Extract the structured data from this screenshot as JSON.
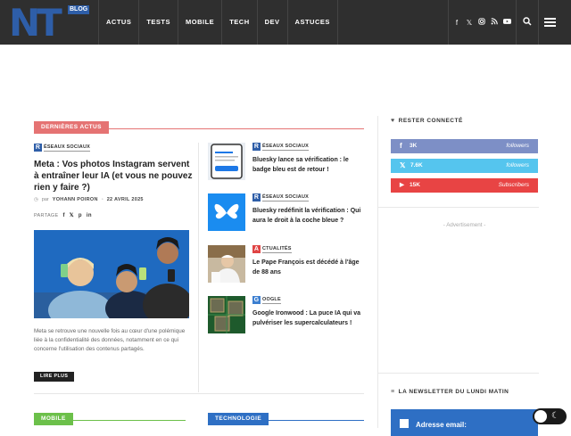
{
  "header": {
    "logo": {
      "text": "NT",
      "tag": "BLOG"
    },
    "nav": [
      "ACTUS",
      "TESTS",
      "MOBILE",
      "TECH",
      "DEV",
      "ASTUCES"
    ],
    "social_icons": [
      "facebook-icon",
      "x-icon",
      "instagram-icon",
      "rss-icon",
      "youtube-icon"
    ]
  },
  "main": {
    "section_label": "DERNIÈRES ACTUS",
    "lead": {
      "category_letter": "R",
      "category_rest": "ÉSEAUX SOCIAUX",
      "title": "Meta : Vos photos Instagram servent à entraîner leur IA (et vous ne pouvez rien y faire ?)",
      "by": "par",
      "author": "YOHANN POIRON",
      "date": "22 AVRIL 2025",
      "share_label": "PARTAGE",
      "share_icons": [
        "f",
        "𝕏",
        "p",
        "in"
      ],
      "excerpt": "Meta se retrouve une nouvelle fois au cœur d'une polémique liée à la confidentialité des données, notamment en ce qui concerne l'utilisation des contenus partagés.",
      "read_more": "LIRE PLUS"
    },
    "side": [
      {
        "cat_letter": "R",
        "cat_rest": "ÉSEAUX SOCIAUX",
        "cat_color": "#2e5ea8",
        "title": "Bluesky lance sa vérification : le badge bleu est de retour !"
      },
      {
        "cat_letter": "R",
        "cat_rest": "ÉSEAUX SOCIAUX",
        "cat_color": "#2e5ea8",
        "title": "Bluesky redéfinit la vérification : Qui aura le droit à la coche bleue ?"
      },
      {
        "cat_letter": "A",
        "cat_rest": "CTUALITÉS",
        "cat_color": "#e04545",
        "title": "Le Pape François est décédé à l'âge de 88 ans"
      },
      {
        "cat_letter": "G",
        "cat_rest": "OOGLE",
        "cat_color": "#3c7fd0",
        "title": "Google Ironwood : La puce IA qui va pulvériser les supercalculateurs !"
      }
    ],
    "bottom_sections": [
      {
        "label": "MOBILE",
        "color": "#6cc04a"
      },
      {
        "label": "TECHNOLOGIE",
        "color": "#2e6fc4"
      }
    ]
  },
  "sidebar": {
    "connect_title": "RESTER CONNECTÉ",
    "socials": [
      {
        "icon": "facebook-icon",
        "glyph": "f",
        "count": "3K",
        "label": "followers",
        "color": "#7d8fc6"
      },
      {
        "icon": "x-icon",
        "glyph": "𝕏",
        "count": "7.6K",
        "label": "followers",
        "color": "#55c5ee"
      },
      {
        "icon": "youtube-icon",
        "glyph": "▶",
        "count": "15K",
        "label": "Subscribers",
        "color": "#e84444"
      }
    ],
    "ad_text": "- Advertisement -",
    "newsletter_title": "LA NEWSLETTER DU LUNDI MATIN",
    "newsletter_box": "Adresse email:"
  },
  "colors": {
    "accent_red": "#e06a6a",
    "brand_blue": "#2e5ea8"
  }
}
